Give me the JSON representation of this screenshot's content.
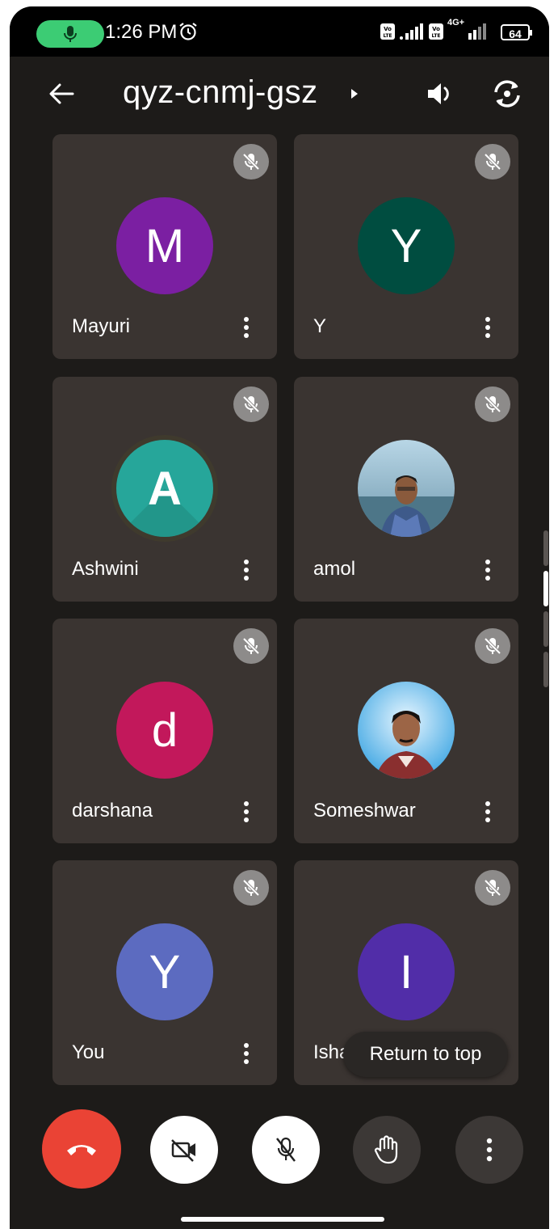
{
  "status_bar": {
    "time": "1:26 PM",
    "battery": "64",
    "network": "4G+",
    "icons": [
      "mic-icon",
      "alarm-icon",
      "volte-icon",
      "signal-icon",
      "volte-icon",
      "signal-icon",
      "battery-icon"
    ],
    "mic_pill_color": "#3ccc74"
  },
  "header": {
    "meeting_code": "qyz-cnmj-gsz",
    "icons": [
      "back-arrow-icon",
      "caret-right-icon",
      "speaker-icon",
      "flip-camera-icon"
    ]
  },
  "participants": [
    {
      "name": "Mayuri",
      "initial": "M",
      "color": "#7b1fa2",
      "muted": true
    },
    {
      "name": "Y",
      "initial": "Y",
      "color": "#004d40",
      "muted": true
    },
    {
      "name": "Ashwini",
      "initial": "A",
      "color": "#26a69a",
      "muted": true
    },
    {
      "name": "amol",
      "initial": "",
      "photo": true,
      "muted": true
    },
    {
      "name": "darshana",
      "initial": "d",
      "color": "#c2185b",
      "muted": true
    },
    {
      "name": "Someshwar",
      "initial": "",
      "photo": true,
      "muted": true
    },
    {
      "name": "You",
      "initial": "Y",
      "color": "#5c6bc0",
      "muted": true
    },
    {
      "name": "Isha",
      "initial": "I",
      "color": "#512da8",
      "muted": true
    }
  ],
  "return_to_top_label": "Return to top",
  "controls": [
    {
      "name": "end-call",
      "icon": "phone-hangup-icon",
      "color": "#ea4335"
    },
    {
      "name": "camera-toggle",
      "icon": "camera-off-icon",
      "color": "#ffffff"
    },
    {
      "name": "mic-toggle",
      "icon": "mic-off-icon",
      "color": "#ffffff"
    },
    {
      "name": "raise-hand",
      "icon": "hand-icon",
      "color": "#3c3836"
    },
    {
      "name": "more-options",
      "icon": "more-vert-icon",
      "color": "#3c3836"
    }
  ]
}
